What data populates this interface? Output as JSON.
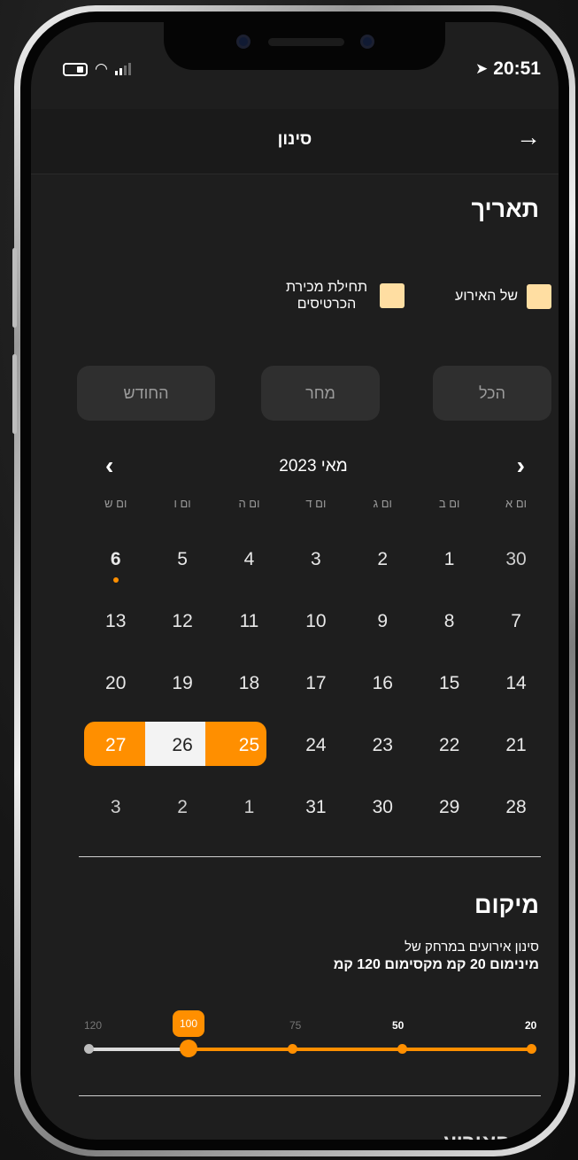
{
  "status_bar": {
    "time": "20:51",
    "location_arrow": "location-arrow-icon"
  },
  "header": {
    "title": "סינון",
    "back_icon": "arrow-right-icon"
  },
  "date_section": {
    "title": "תאריך",
    "checkbox_event": "של האירוע",
    "checkbox_sale": "תחילת מכירת הכרטיסים"
  },
  "quick_buttons": {
    "all": "הכל",
    "tomorrow": "מחר",
    "month": "החודש"
  },
  "calendar": {
    "month_label": "מאי 2023",
    "weekdays": [
      "ום א",
      "ום ב",
      "ום ג",
      "ום ד",
      "ום ה",
      "ום ו",
      "ום ש"
    ],
    "weeks": [
      [
        "30",
        "1",
        "2",
        "3",
        "4",
        "5",
        "6"
      ],
      [
        "7",
        "8",
        "9",
        "10",
        "11",
        "12",
        "13"
      ],
      [
        "14",
        "15",
        "16",
        "17",
        "18",
        "19",
        "20"
      ],
      [
        "21",
        "22",
        "23",
        "24",
        "25",
        "26",
        "27"
      ],
      [
        "28",
        "29",
        "30",
        "31",
        "1",
        "2",
        "3"
      ]
    ],
    "today": "6",
    "range_start": "25",
    "range_middle": "26",
    "range_end": "27",
    "accent_color": "#ff8f00",
    "checkbox_color": "#ffdea2"
  },
  "location_section": {
    "title": "מיקום",
    "description": "סינון  אירועים במרחק של",
    "range_text": "מינימום 20 קמ מקסימום 120 קמ",
    "slider": {
      "labels": [
        "20",
        "50",
        "75",
        "100",
        "120"
      ],
      "current_value": "100"
    }
  },
  "next_section_hint": "ר האירוע"
}
